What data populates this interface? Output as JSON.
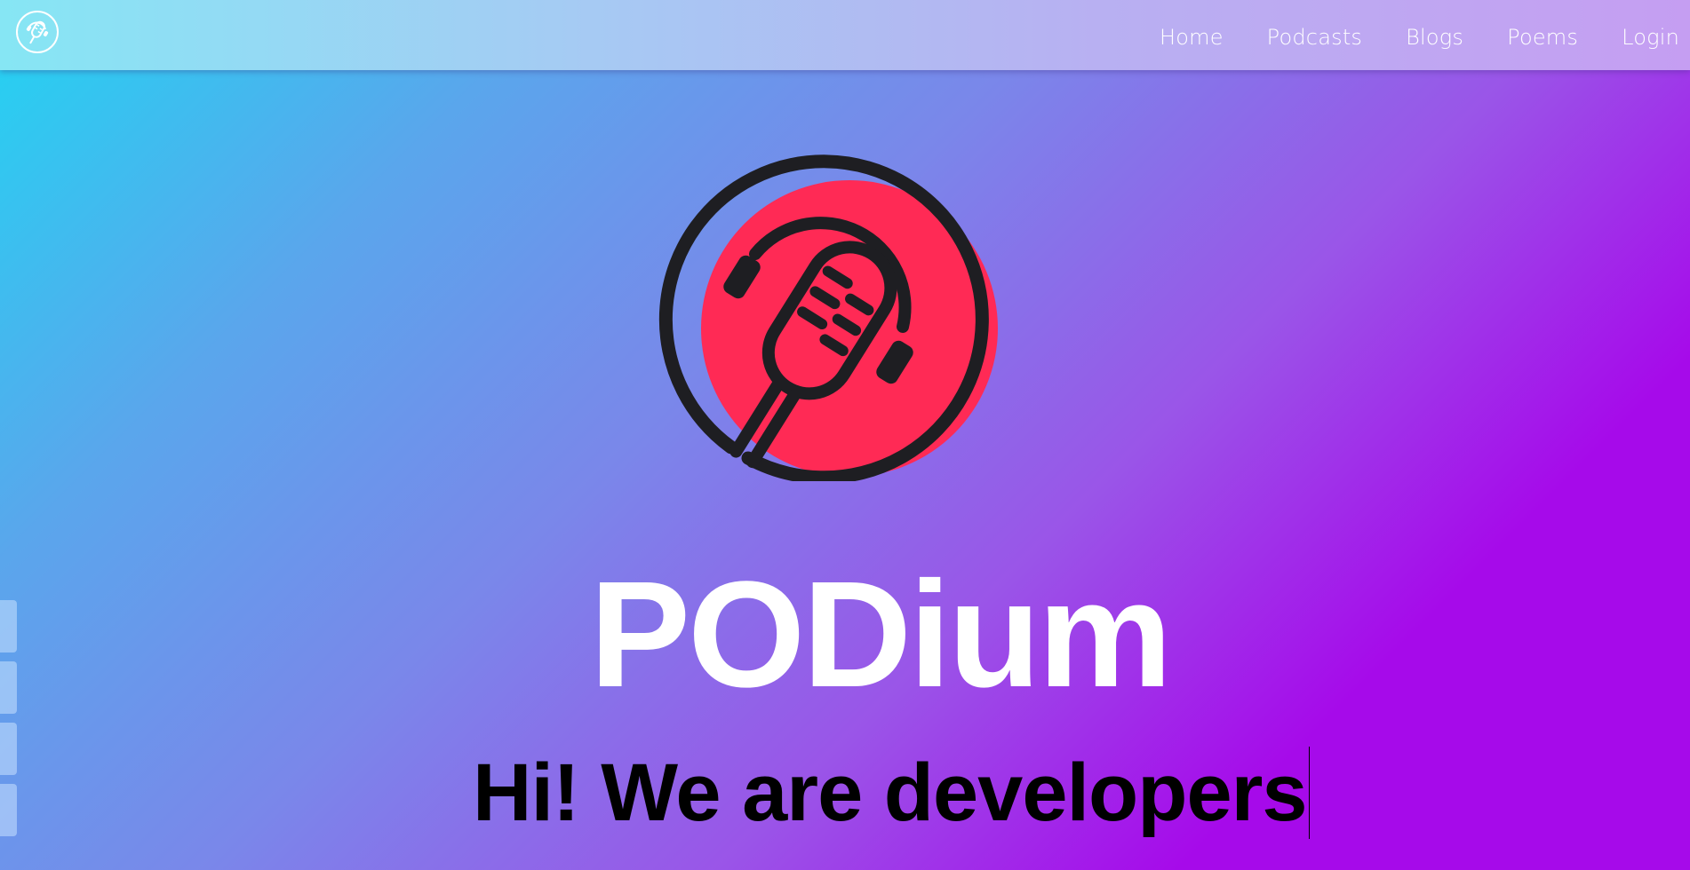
{
  "brand": {
    "name": "PODium",
    "logo_icon": "microphone-headphones-icon",
    "colors": {
      "accent_red": "#ff2a55",
      "outline": "#1e1e22",
      "gradient_start": "#22d4f2",
      "gradient_end": "#a60aea"
    }
  },
  "nav": {
    "items": [
      {
        "label": "Home"
      },
      {
        "label": "Podcasts"
      },
      {
        "label": "Blogs"
      },
      {
        "label": "Poems"
      },
      {
        "label": "Login"
      }
    ]
  },
  "hero": {
    "title": "PODium",
    "tagline": "Hi! We are developers"
  },
  "side_tabs": {
    "count": 4
  }
}
